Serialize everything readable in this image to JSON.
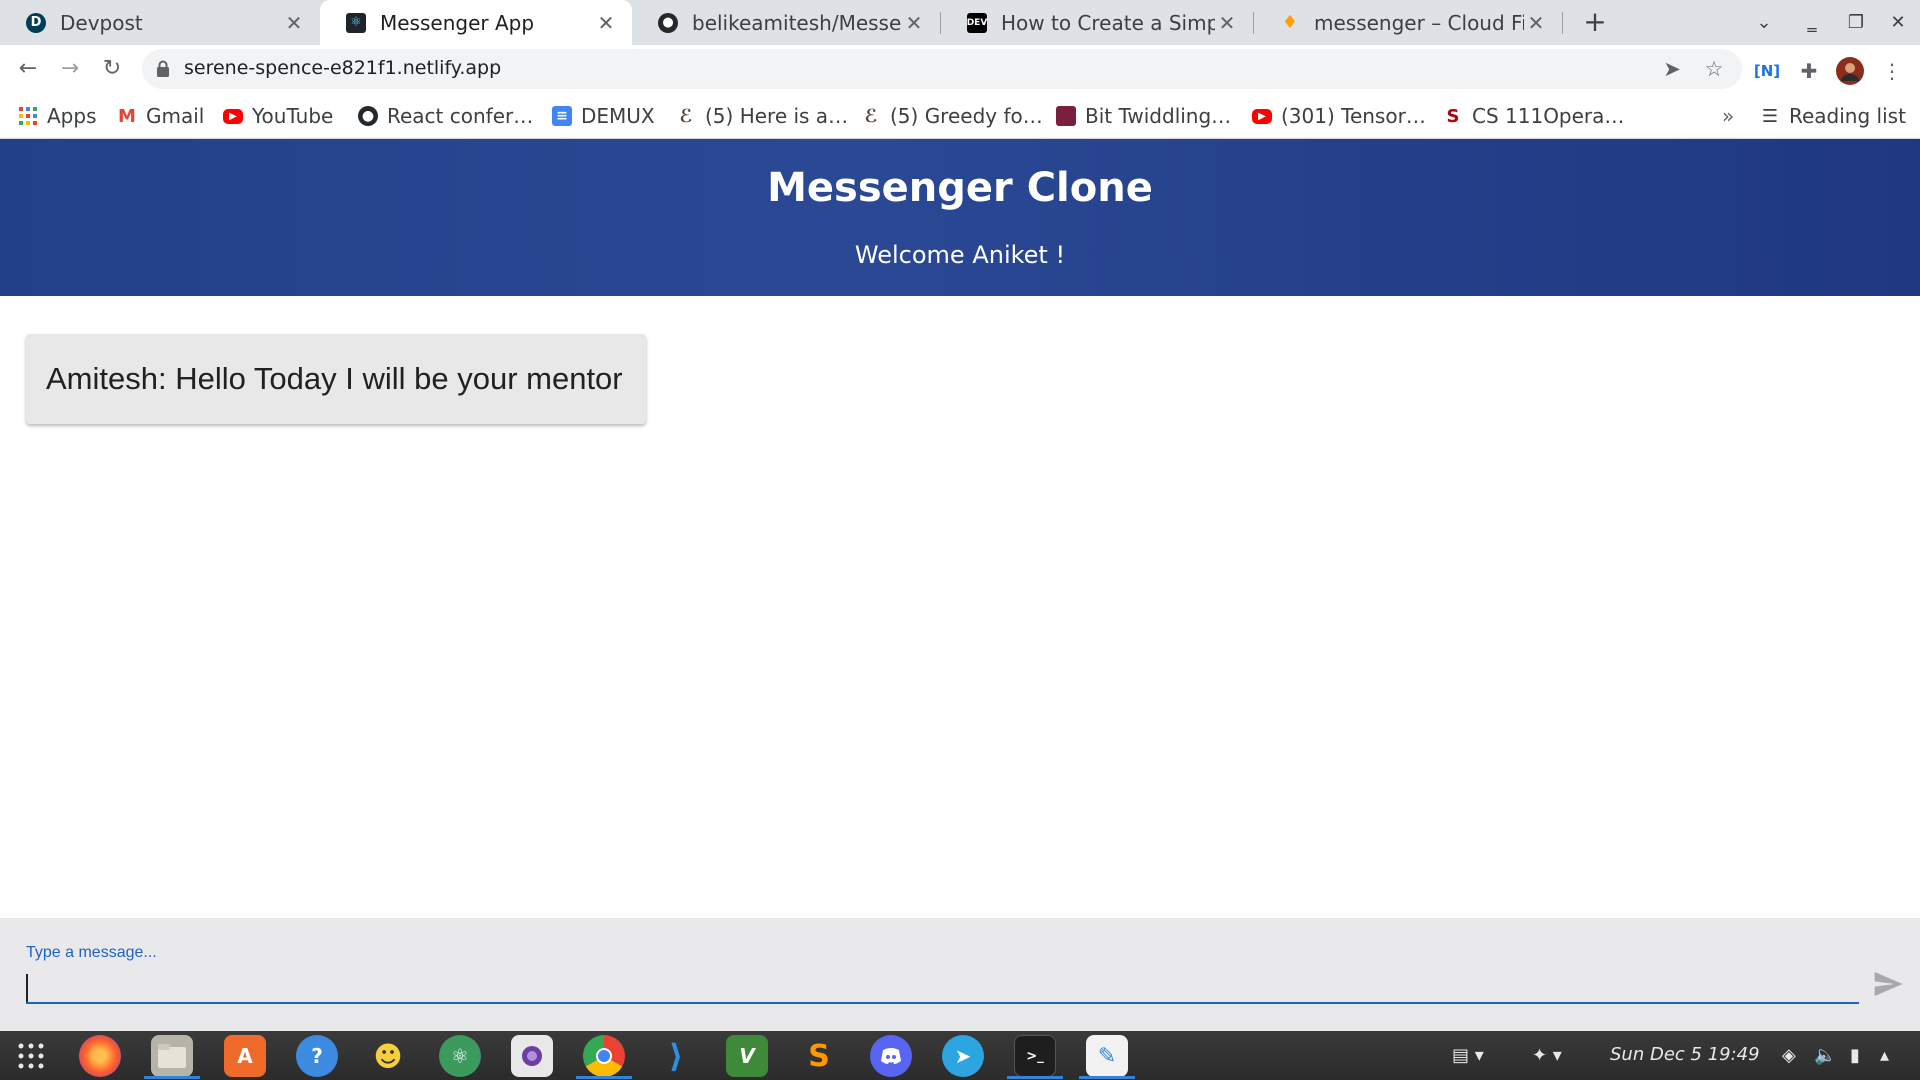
{
  "browser": {
    "tabs": [
      {
        "title": "Devpost",
        "icon": "devpost-icon"
      },
      {
        "title": "Messenger App",
        "icon": "react-icon",
        "active": true
      },
      {
        "title": "belikeamitesh/Messeng",
        "icon": "github-icon"
      },
      {
        "title": "How to Create a Simple",
        "icon": "dev-icon"
      },
      {
        "title": "messenger – Cloud Fires",
        "icon": "firebase-icon"
      }
    ],
    "new_tab": "+",
    "url": "serene-spence-e821f1.netlify.app",
    "bookmarks": [
      {
        "label": "Apps",
        "icon": "apps-grid-icon"
      },
      {
        "label": "Gmail",
        "icon": "gmail-icon"
      },
      {
        "label": "YouTube",
        "icon": "youtube-icon"
      },
      {
        "label": "React confer…",
        "icon": "github-icon"
      },
      {
        "label": "DEMUX",
        "icon": "docs-icon"
      },
      {
        "label": "(5) Here is a…",
        "icon": "codechef-icon"
      },
      {
        "label": "(5) Greedy fo…",
        "icon": "codechef-icon"
      },
      {
        "label": "Bit Twiddling…",
        "icon": "site-icon"
      },
      {
        "label": "(301) Tensor…",
        "icon": "youtube-icon"
      },
      {
        "label": "CS 111Opera…",
        "icon": "stanford-icon"
      }
    ],
    "bookmarks_overflow": "»",
    "reading_list": "Reading list"
  },
  "app": {
    "title": "Messenger Clone",
    "welcome": "Welcome Aniket !",
    "messages": [
      {
        "text": "Amitesh: Hello Today I will be your mentor"
      }
    ],
    "compose": {
      "label": "Type a message...",
      "value": ""
    }
  },
  "taskbar": {
    "clock": "Sun Dec 5  19:49",
    "apps": [
      "show-apps-icon",
      "firefox-icon",
      "files-icon",
      "software-center-icon",
      "help-icon",
      "pikachu-icon",
      "atom-icon",
      "screen-recorder-icon",
      "chrome-icon",
      "vscode-icon",
      "vim-icon",
      "sublime-icon",
      "discord-icon",
      "telegram-icon",
      "terminal-icon",
      "text-editor-icon"
    ]
  },
  "colors": {
    "header_bg": "#23418a",
    "accent": "#1f63c4",
    "message_bg": "#e8e8e8",
    "compose_bg": "#e9e9ec"
  }
}
